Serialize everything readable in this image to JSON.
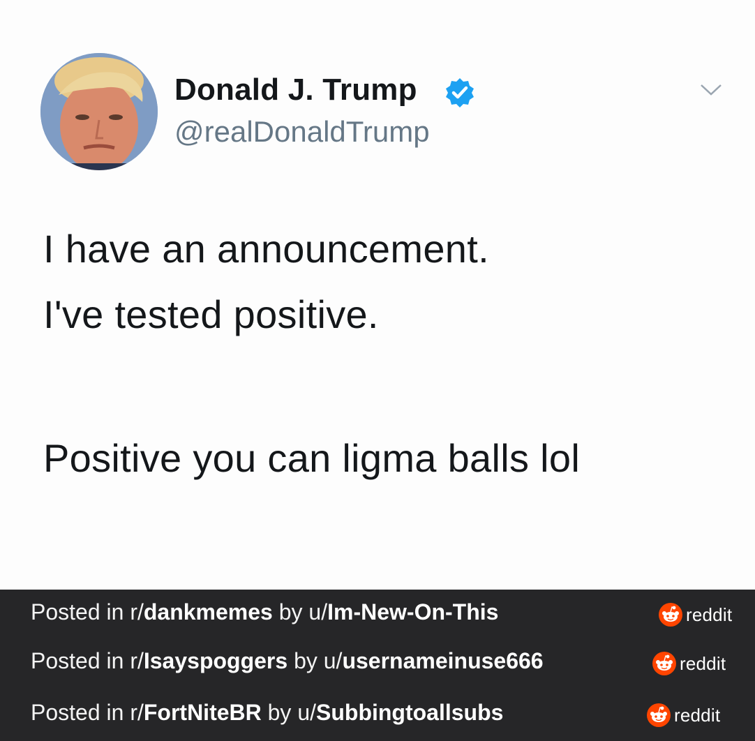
{
  "tweet": {
    "display_name": "Donald J. Trump",
    "handle": "@realDonaldTrump",
    "lines": [
      "I have an announcement.",
      "I've tested positive.",
      "Positive you can ligma balls lol"
    ],
    "verified_color": "#1da1f2"
  },
  "footer": {
    "posts": [
      {
        "prefix": "Posted in r/",
        "subreddit": "dankmemes",
        "by": " by u/",
        "user": "Im-New-On-This",
        "badge_label": "reddit"
      },
      {
        "prefix": "Posted in r/",
        "subreddit": "Isayspoggers",
        "by": " by u/",
        "user": "usernameinuse666",
        "badge_label": "reddit"
      },
      {
        "prefix": "Posted in r/",
        "subreddit": "FortNiteBR",
        "by": " by u/",
        "user": "Subbingtoallsubs",
        "badge_label": "reddit"
      }
    ],
    "reddit_color": "#ff4500",
    "icon": "reddit-logo-icon"
  }
}
